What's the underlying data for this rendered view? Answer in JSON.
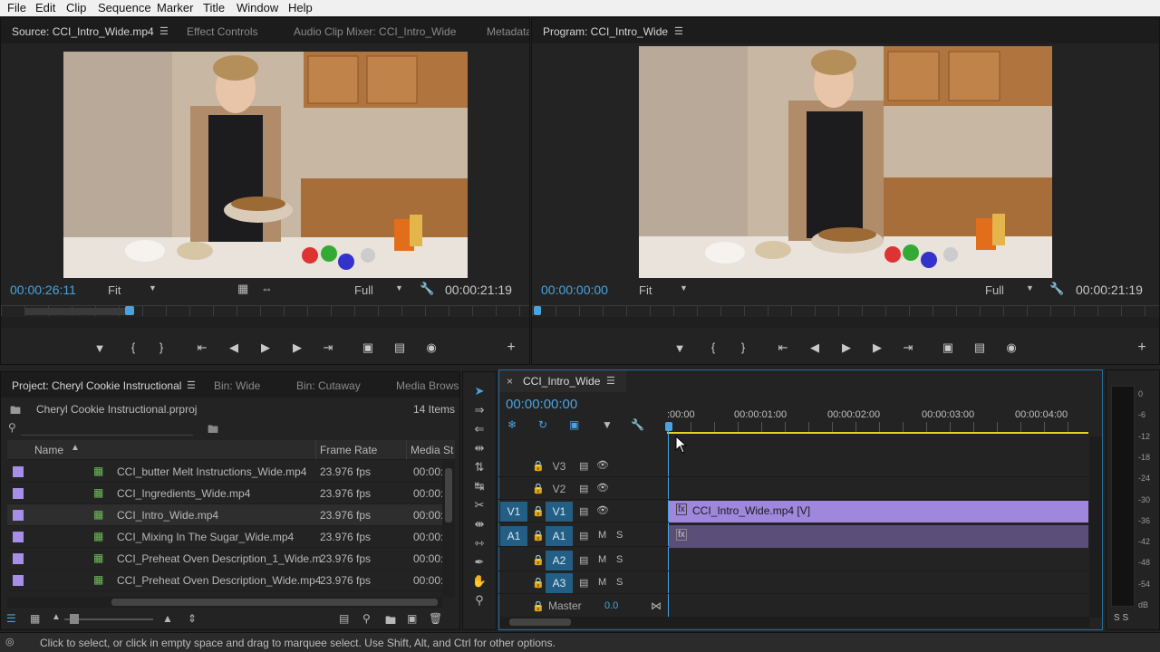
{
  "menu": [
    "File",
    "Edit",
    "Clip",
    "Sequence",
    "Marker",
    "Title",
    "Window",
    "Help"
  ],
  "source_panel": {
    "tabs": [
      "Source: CCI_Intro_Wide.mp4",
      "Effect Controls",
      "Audio Clip Mixer: CCI_Intro_Wide",
      "Metadata"
    ],
    "timecode_left": "00:00:26:11",
    "fit": "Fit",
    "resolution": "Full",
    "timecode_right": "00:00:21:19"
  },
  "program_panel": {
    "tab": "Program: CCI_Intro_Wide",
    "timecode_left": "00:00:00:00",
    "fit": "Fit",
    "resolution": "Full",
    "timecode_right": "00:00:21:19"
  },
  "project_panel": {
    "tabs": [
      "Project: Cheryl Cookie Instructional",
      "Bin: Wide",
      "Bin: Cutaway",
      "Media Browser"
    ],
    "project_file": "Cheryl Cookie Instructional.prproj",
    "item_count": "14 Items",
    "columns": [
      "Name",
      "Frame Rate",
      "Media Start"
    ],
    "rows": [
      {
        "name": "CCI_butter Melt Instructions_Wide.mp4",
        "fps": "23.976 fps",
        "start": "00:00:"
      },
      {
        "name": "CCI_Ingredients_Wide.mp4",
        "fps": "23.976 fps",
        "start": "00:00:"
      },
      {
        "name": "CCI_Intro_Wide.mp4",
        "fps": "23.976 fps",
        "start": "00:00:"
      },
      {
        "name": "CCI_Mixing In The Sugar_Wide.mp4",
        "fps": "23.976 fps",
        "start": "00:00:"
      },
      {
        "name": "CCI_Preheat Oven Description_1_Wide.m",
        "fps": "23.976 fps",
        "start": "00:00:"
      },
      {
        "name": "CCI_Preheat Oven Description_Wide.mp4",
        "fps": "23.976 fps",
        "start": "00:00:"
      }
    ]
  },
  "timeline": {
    "tab": "CCI_Intro_Wide",
    "timecode": "00:00:00:00",
    "ruler": [
      ":00:00",
      "00:00:01:00",
      "00:00:02:00",
      "00:00:03:00",
      "00:00:04:00"
    ],
    "tracks": [
      "V3",
      "V2",
      "V1",
      "A1",
      "A2",
      "A3"
    ],
    "source_patch_v": "V1",
    "source_patch_a": "A1",
    "mute_label": "M",
    "solo_label": "S",
    "master_label": "Master",
    "master_value": "0.0",
    "clip_video": "CCI_Intro_Wide.mp4 [V]",
    "clip_fx": "fx"
  },
  "meter": {
    "labels": [
      "0",
      "-6",
      "-12",
      "-18",
      "-24",
      "-30",
      "-36",
      "-42",
      "-48",
      "-54",
      "dB"
    ],
    "bottom": "S S"
  },
  "status_bar": "Click to select, or click in empty space and drag to marquee select. Use Shift, Alt, and Ctrl for other options.",
  "colors": {
    "accent": "#4aa3df",
    "clip_video": "#9f87dd",
    "clip_audio": "#5b4f7a",
    "swatch": "#a78ee6"
  }
}
